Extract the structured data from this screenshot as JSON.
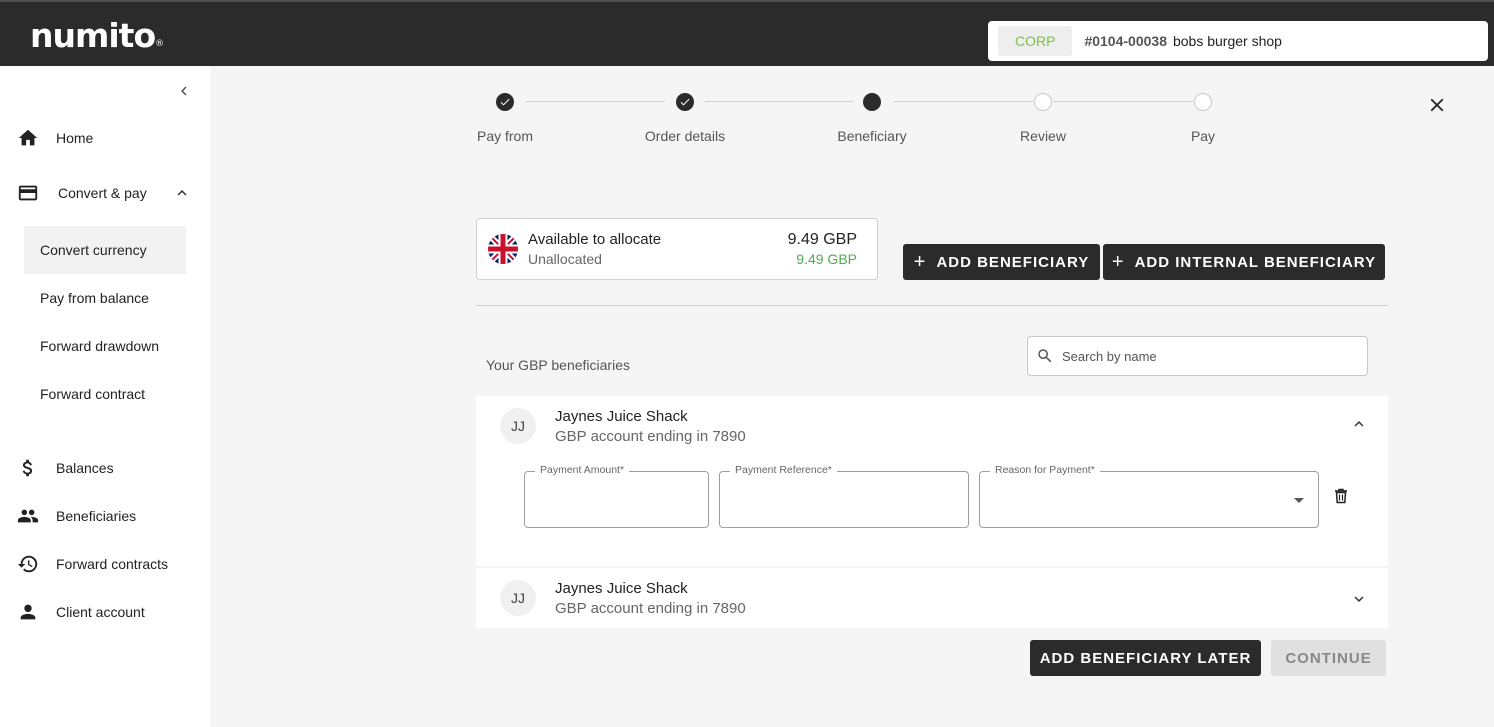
{
  "header": {
    "logo": "numito",
    "logo_mark": "®",
    "account": {
      "badge": "CORP",
      "number": "#0104-00038",
      "name": "bobs burger shop"
    }
  },
  "sidebar": {
    "items": [
      {
        "label": "Home",
        "icon": "home-icon"
      },
      {
        "label": "Convert & pay",
        "icon": "wallet-icon"
      },
      {
        "label": "Balances",
        "icon": "dollar-icon"
      },
      {
        "label": "Beneficiaries",
        "icon": "people-icon"
      },
      {
        "label": "Forward contracts",
        "icon": "history-icon"
      },
      {
        "label": "Client account",
        "icon": "person-icon"
      }
    ],
    "sub_items": [
      {
        "label": "Convert currency",
        "active": true
      },
      {
        "label": "Pay from balance"
      },
      {
        "label": "Forward drawdown"
      },
      {
        "label": "Forward contract"
      }
    ]
  },
  "stepper": {
    "steps": [
      {
        "label": "Pay from",
        "state": "done"
      },
      {
        "label": "Order details",
        "state": "done"
      },
      {
        "label": "Beneficiary",
        "state": "current"
      },
      {
        "label": "Review",
        "state": "todo"
      },
      {
        "label": "Pay",
        "state": "todo"
      }
    ]
  },
  "allocate": {
    "title": "Available to allocate",
    "subtitle": "Unallocated",
    "amount": "9.49 GBP",
    "unallocated_amount": "9.49 GBP",
    "flag": "uk-flag"
  },
  "actions": {
    "add_beneficiary": "ADD BENEFICIARY",
    "add_internal_beneficiary": "ADD INTERNAL BENEFICIARY",
    "add_later": "ADD BENEFICIARY LATER",
    "continue": "CONTINUE"
  },
  "beneficiaries": {
    "heading": "Your GBP beneficiaries",
    "search_placeholder": "Search by name",
    "list": [
      {
        "initials": "JJ",
        "name": "Jaynes Juice Shack",
        "account": "GBP account ending in 7890",
        "expanded": true
      },
      {
        "initials": "JJ",
        "name": "Jaynes Juice Shack",
        "account": "GBP account ending in 7890",
        "expanded": false
      }
    ],
    "form": {
      "payment_amount_label": "Payment Amount*",
      "payment_reference_label": "Payment Reference*",
      "reason_label": "Reason for Payment*",
      "payment_amount": "",
      "payment_reference": "",
      "reason": ""
    }
  },
  "colors": {
    "dark": "#2b2b2b",
    "corp": "#7bc142",
    "green": "#4caf50"
  }
}
